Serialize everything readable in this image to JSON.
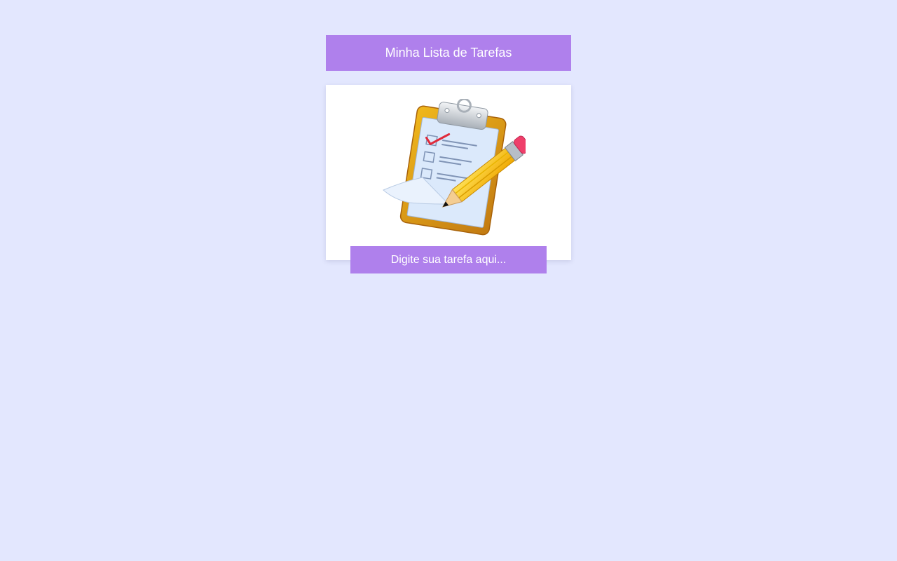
{
  "header": {
    "title": "Minha Lista de Tarefas"
  },
  "illustration": {
    "icon": "clipboard-checklist-pencil-icon"
  },
  "task_input": {
    "placeholder": "Digite sua tarefa aqui...",
    "value": ""
  },
  "tasks": [],
  "colors": {
    "background": "#e3e7fe",
    "accent": "#af80ec",
    "card": "#ffffff",
    "text_on_accent": "#ffffff"
  }
}
